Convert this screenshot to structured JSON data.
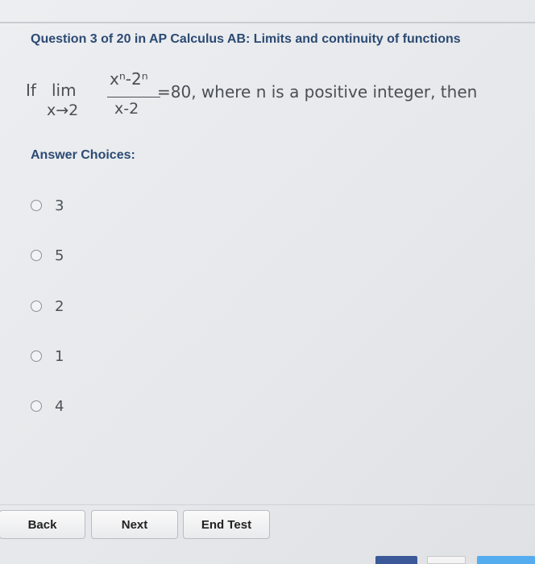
{
  "header": {
    "title": "Question 3 of 20 in AP Calculus AB: Limits and continuity of functions"
  },
  "question": {
    "prefix": "If",
    "lim": "lim",
    "limit_sub": "x→2",
    "numerator": "xⁿ-2ⁿ",
    "denominator": "x-2",
    "suffix": "=80, where n is a positive integer, then"
  },
  "answers": {
    "label": "Answer Choices:",
    "choices": [
      "3",
      "5",
      "2",
      "1",
      "4"
    ]
  },
  "footer": {
    "back_label": "Back",
    "next_label": "Next",
    "end_label": "End Test"
  },
  "colors": {
    "heading": "#2c4a73",
    "facebook": "#3b5998",
    "twitter": "#55acee"
  }
}
